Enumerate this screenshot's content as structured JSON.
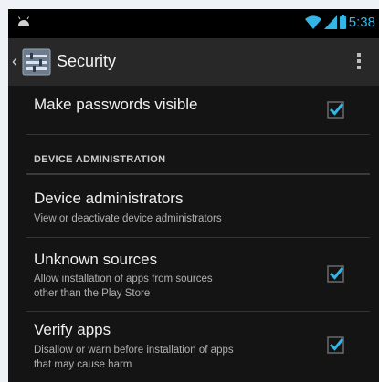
{
  "status_bar": {
    "time": "5:38",
    "icons": [
      "android-icon",
      "wifi-icon",
      "signal-icon",
      "battery-icon"
    ],
    "accent_color": "#33b5e5"
  },
  "action_bar": {
    "title": "Security",
    "icons": [
      "back-icon",
      "settings-app-icon",
      "overflow-menu-icon"
    ]
  },
  "settings": {
    "make_passwords_visible": {
      "title": "Make passwords visible",
      "checked": true
    },
    "section_header": "DEVICE ADMINISTRATION",
    "device_administrators": {
      "title": "Device administrators",
      "summary": "View or deactivate device administrators"
    },
    "unknown_sources": {
      "title": "Unknown sources",
      "summary_line1": "Allow installation of apps from sources",
      "summary_line2": "other than the Play Store",
      "checked": true
    },
    "verify_apps": {
      "title": "Verify apps",
      "summary_line1": "Disallow or warn before installation of apps",
      "summary_line2": "that may cause harm",
      "checked": true
    }
  }
}
